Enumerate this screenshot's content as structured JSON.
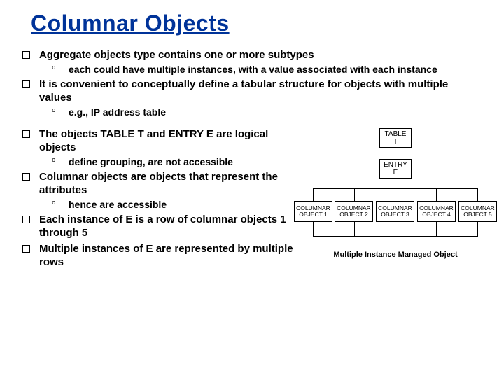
{
  "title": "Columnar Objects",
  "bullets_top": [
    {
      "text": "Aggregate objects type contains one or more subtypes",
      "sub": [
        "each could have multiple instances, with a value associated with each instance"
      ]
    },
    {
      "text": "It is convenient to conceptually define a tabular structure for objects with multiple values",
      "sub": [
        "e.g., IP address table"
      ]
    }
  ],
  "bullets_left": [
    {
      "text": "The objects TABLE T and ENTRY E are logical objects",
      "sub": [
        "define grouping, are not accessible"
      ]
    },
    {
      "text": "Columnar objects are objects that represent the attributes",
      "sub": [
        "hence are accessible"
      ]
    },
    {
      "text": "Each instance of E is a row of columnar objects 1 through 5",
      "sub": []
    },
    {
      "text": "Multiple instances of E are represented by multiple rows",
      "sub": []
    }
  ],
  "diagram": {
    "table_label": "TABLE\nT",
    "entry_label": "ENTRY\nE",
    "columns": [
      "COLUMNAR OBJECT 1",
      "COLUMNAR OBJECT 2",
      "COLUMNAR OBJECT 3",
      "COLUMNAR OBJECT 4",
      "COLUMNAR OBJECT 5"
    ],
    "caption": "Multiple Instance Managed Object"
  }
}
